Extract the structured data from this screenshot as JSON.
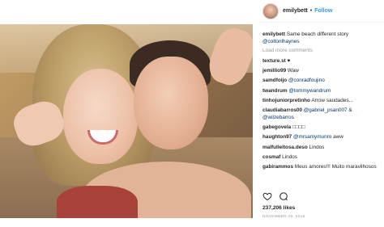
{
  "header": {
    "username": "emilybett",
    "separator": "•",
    "follow_label": "Follow"
  },
  "caption": {
    "username": "emilybett",
    "text": " Same beach different story",
    "mention": "@coltonlhaynes"
  },
  "load_more_label": "Load more comments",
  "comments": [
    {
      "user": "texture.st",
      "text": " ♥",
      "mention": ""
    },
    {
      "user": "jemillio99",
      "text": " Waw",
      "mention": ""
    },
    {
      "user": "samdfoijo",
      "text": "",
      "mention": " @conradfoujino"
    },
    {
      "user": "twandrum",
      "text": "",
      "mention": " @tommywandrum"
    },
    {
      "user": "tinhojuniorpretinho",
      "text": " Arrow saudades...",
      "mention": ""
    },
    {
      "user": "claudiabarros00",
      "text": "",
      "mention": " @gabriel_psan007 & @wilzebarros"
    },
    {
      "user": "gabegovela",
      "text": " □□□□",
      "mention": ""
    },
    {
      "user": "haughton97",
      "text": "",
      "mention": " @mrsamymunro ",
      "tail": "aww"
    },
    {
      "user": "malfulleitosa.deso",
      "text": " Lindos",
      "mention": ""
    },
    {
      "user": "cosmaf",
      "text": " Lindos",
      "mention": ""
    },
    {
      "user": "gabirammos",
      "text": " Meus amores!!! Muito maravilhosos",
      "mention": ""
    }
  ],
  "likes": "237,206 likes",
  "date": "NOVEMBER 26, 2016",
  "icons": {
    "like": "heart-icon",
    "comment": "comment-bubble-icon"
  },
  "colors": {
    "link": "#003569",
    "follow": "#3897f0",
    "muted": "#999999"
  }
}
